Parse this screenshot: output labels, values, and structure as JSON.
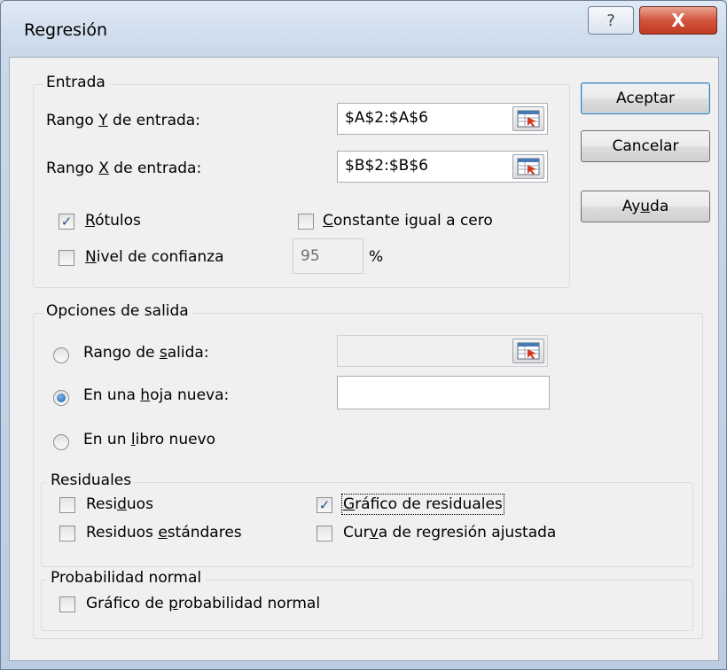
{
  "window": {
    "title": "Regresión",
    "help_label": "?",
    "close_label": "X"
  },
  "entrada": {
    "title": "Entrada",
    "rango_y": {
      "label_pre": "Rango ",
      "label_key": "Y",
      "label_post": " de entrada:",
      "value": "$A$2:$A$6"
    },
    "rango_x": {
      "label_pre": "Rango ",
      "label_key": "X",
      "label_post": " de entrada:",
      "value": "$B$2:$B$6"
    },
    "rotulos": {
      "key": "R",
      "rest": "ótulos",
      "checked": true
    },
    "constante": {
      "key": "C",
      "rest": "onstante igual a cero",
      "checked": false
    },
    "nivel": {
      "key": "N",
      "rest": "ivel de confianza",
      "checked": false,
      "value": "95",
      "unit": "%"
    }
  },
  "buttons": {
    "aceptar": "Aceptar",
    "cancelar": "Cancelar",
    "ayuda_pre": "Ay",
    "ayuda_key": "u",
    "ayuda_post": "da"
  },
  "salida": {
    "title": "Opciones de salida",
    "rango": {
      "pre": "Rango de ",
      "key": "s",
      "post": "alida:",
      "selected": false,
      "value": ""
    },
    "hoja": {
      "pre": "En una ",
      "key": "h",
      "post": "oja nueva:",
      "selected": true,
      "value": ""
    },
    "libro": {
      "pre": "En un ",
      "key": "l",
      "post": "ibro nuevo",
      "selected": false
    }
  },
  "residuales": {
    "title": "Residuales",
    "residuos": {
      "pre": "Resi",
      "key": "d",
      "post": "uos",
      "checked": false
    },
    "estandares": {
      "pre": "Residuos ",
      "key": "e",
      "post": "stándares",
      "checked": false
    },
    "grafico": {
      "pre": "",
      "key": "G",
      "post": "ráfico de residuales",
      "checked": true
    },
    "curva": {
      "pre": "Cur",
      "key": "v",
      "post": "a de regresión ajustada",
      "checked": false
    }
  },
  "probabilidad": {
    "title": "Probabilidad normal",
    "grafico": {
      "pre": "Gráfico de ",
      "key": "p",
      "post": "robabilidad normal",
      "checked": false
    }
  },
  "icons": {
    "check": "✓",
    "ref_button": "range-selector-icon"
  }
}
